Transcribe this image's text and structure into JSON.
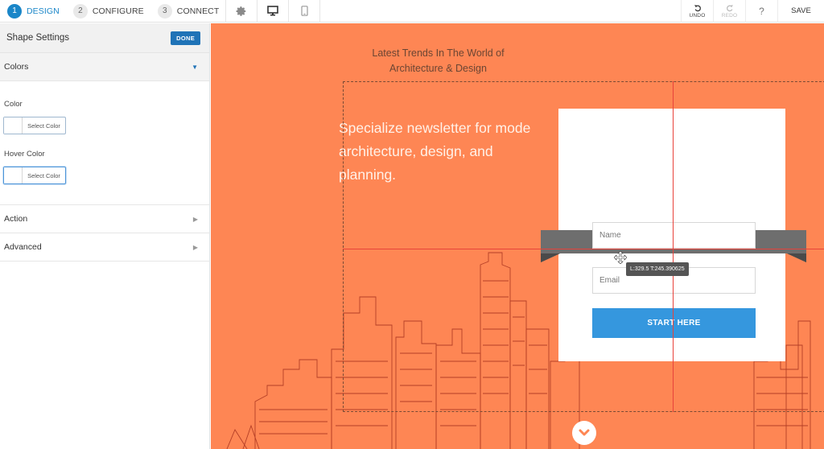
{
  "steps": [
    {
      "num": "1",
      "label": "DESIGN"
    },
    {
      "num": "2",
      "label": "CONFIGURE"
    },
    {
      "num": "3",
      "label": "CONNECT"
    }
  ],
  "toolbar": {
    "undo": "UNDO",
    "redo": "REDO",
    "help": "?",
    "save": "SAVE",
    "icons": [
      "gear-icon",
      "desktop-icon",
      "mobile-icon",
      "undo-icon",
      "redo-icon"
    ]
  },
  "sidebar": {
    "title": "Shape Settings",
    "done": "DONE",
    "sections": {
      "colors": "Colors",
      "action": "Action",
      "advanced": "Advanced"
    },
    "fields": [
      {
        "label": "Color",
        "button": "Select Color"
      },
      {
        "label": "Hover Color",
        "button": "Select Color"
      }
    ]
  },
  "canvas": {
    "kicker": [
      "Latest Trends In The World of",
      "Architecture & Design"
    ],
    "headline": [
      "Specialize newsletter for mode",
      "architecture, design, and",
      "planning."
    ],
    "name_placeholder": "Name",
    "email_placeholder": "Email",
    "cta": "START HERE",
    "coords": "L:329.5 T:245.390625"
  },
  "colors": {
    "accent": "#1a86c8",
    "canvas_bg": "#fe8654",
    "cta_bg": "#3597de",
    "guide_line": "#e8423a",
    "ribbon": "#6e6e6e"
  }
}
